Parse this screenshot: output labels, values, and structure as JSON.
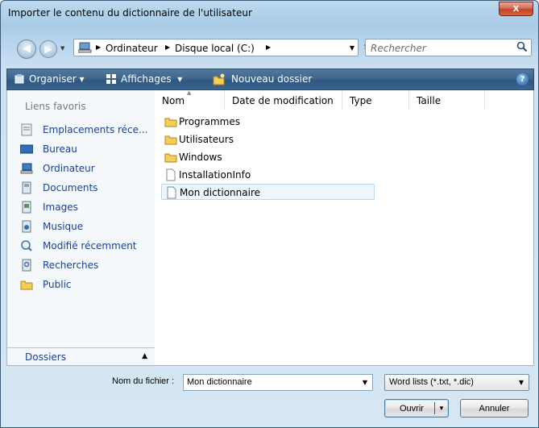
{
  "window": {
    "title": "Importer le contenu du dictionnaire de l'utilisateur",
    "close_label": "x"
  },
  "address": {
    "segments": [
      "Ordinateur",
      "Disque local (C:)"
    ],
    "search_placeholder": "Rechercher"
  },
  "toolbar": {
    "organize": "Organiser",
    "views": "Affichages",
    "new_folder": "Nouveau dossier",
    "help_label": "?"
  },
  "sidebar": {
    "favorites_label": "Liens favoris",
    "items": [
      {
        "label": "Emplacements réce...",
        "icon": "recent-places-icon"
      },
      {
        "label": "Bureau",
        "icon": "desktop-icon"
      },
      {
        "label": "Ordinateur",
        "icon": "computer-icon"
      },
      {
        "label": "Documents",
        "icon": "documents-icon"
      },
      {
        "label": "Images",
        "icon": "pictures-icon"
      },
      {
        "label": "Musique",
        "icon": "music-icon"
      },
      {
        "label": "Modifié récemment",
        "icon": "recently-changed-icon"
      },
      {
        "label": "Recherches",
        "icon": "searches-icon"
      },
      {
        "label": "Public",
        "icon": "public-folder-icon"
      }
    ],
    "folders_label": "Dossiers"
  },
  "file_list": {
    "columns": [
      "Nom",
      "Date de modification",
      "Type",
      "Taille"
    ],
    "rows": [
      {
        "name": "Programmes",
        "kind": "folder"
      },
      {
        "name": "Utilisateurs",
        "kind": "folder"
      },
      {
        "name": "Windows",
        "kind": "folder"
      },
      {
        "name": "InstallationInfo",
        "kind": "file"
      },
      {
        "name": "Mon dictionnaire",
        "kind": "file",
        "selected": true
      }
    ]
  },
  "footer": {
    "filename_label": "Nom du fichier :",
    "filename_value": "Mon dictionnaire",
    "filter_value": "Word lists (*.txt, *.dic)",
    "open_label": "Ouvrir",
    "cancel_label": "Annuler"
  },
  "colors": {
    "accent": "#1a3f97",
    "toolbar": "#3f668e",
    "selection": "#eef6fc"
  }
}
